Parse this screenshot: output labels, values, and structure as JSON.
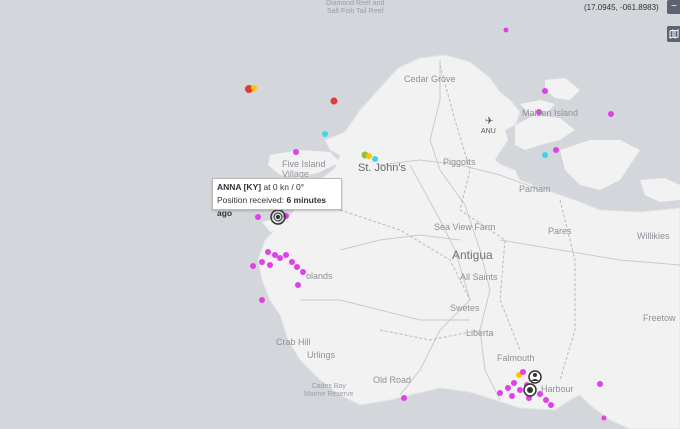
{
  "coordinates": "(17.0945, -061.8983)",
  "controls": {
    "top_symbol": "−",
    "layers_icon": "map-icon"
  },
  "tooltip": {
    "vessel": "ANNA [KY]",
    "speed_text": "at 0 kn / 0°",
    "position_label": "Position received:",
    "position_age": "6 minutes ago"
  },
  "places": {
    "diamond_reef_1": "Diamond Reef and",
    "diamond_reef_2": "Salt Fish Tail Reef",
    "cedar_grove": "Cedar Grove",
    "maiden_island": "Maiden Island",
    "anu": "ANU",
    "five_islands_1": "Five Island",
    "five_islands_2": "Village",
    "st_johns": "St. John's",
    "piggotts": "Piggotts",
    "parham": "Parham",
    "sea_view_farm": "Sea View Farm",
    "pares": "Pares",
    "willikies": "Willikies",
    "antigua": "Antigua",
    "all_saints": "All Saints",
    "jolly_harbour": "olands",
    "swetes": "Swetes",
    "liberta": "Liberta",
    "freetown": "Freetow",
    "crab_hill": "Crab Hill",
    "urlings": "Urlings",
    "falmouth": "Falmouth",
    "english_harbour": "Harbour",
    "old_road": "Old Road",
    "cades_bay_1": "Cades Bay",
    "cades_bay_2": "Marine Reserve"
  },
  "colors": {
    "sea": "#d3d6da",
    "land": "#f2f2f2",
    "vessel_pleasure": "#e040e8",
    "vessel_cargo": "#3dd6e6",
    "vessel_tanker": "#e53935",
    "vessel_other": "#ffc400",
    "vessel_fishing": "#8bc34a"
  }
}
